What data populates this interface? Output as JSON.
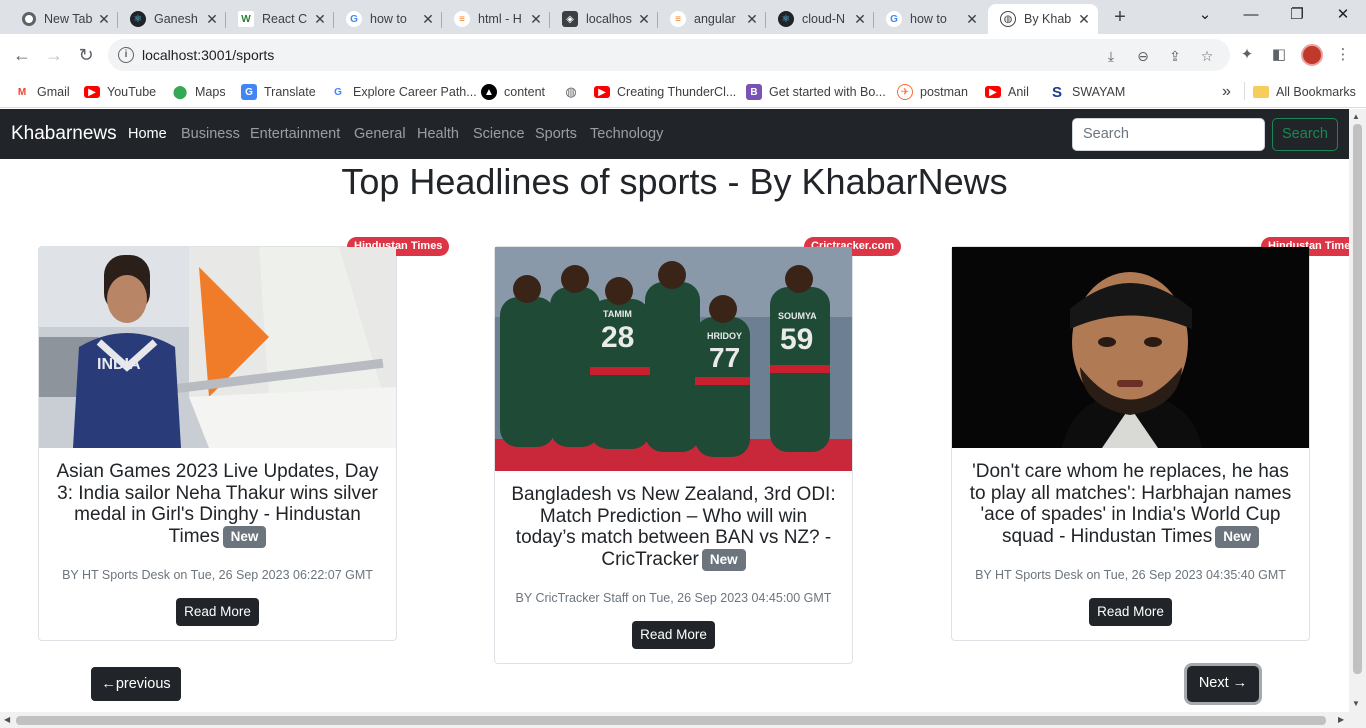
{
  "browser": {
    "tabs": [
      {
        "title": "New Tab"
      },
      {
        "title": "Ganesh"
      },
      {
        "title": "React C"
      },
      {
        "title": "how to"
      },
      {
        "title": "html - H"
      },
      {
        "title": "localhos"
      },
      {
        "title": "angular"
      },
      {
        "title": "cloud-N"
      },
      {
        "title": "how to"
      },
      {
        "title": "By Khab"
      }
    ],
    "url": "localhost:3001/sports",
    "bookmarks": [
      {
        "label": "Gmail",
        "icon": "gmail-icon"
      },
      {
        "label": "YouTube",
        "icon": "youtube-icon"
      },
      {
        "label": "Maps",
        "icon": "maps-icon"
      },
      {
        "label": "Translate",
        "icon": "translate-icon"
      },
      {
        "label": "Explore Career Path...",
        "icon": "career-icon"
      },
      {
        "label": "content",
        "icon": "content-icon"
      },
      {
        "label": "",
        "icon": "globe-icon"
      },
      {
        "label": "Creating ThunderCl...",
        "icon": "youtube-icon"
      },
      {
        "label": "Get started with Bo...",
        "icon": "bootstrap-icon"
      },
      {
        "label": "postman",
        "icon": "postman-icon"
      },
      {
        "label": "Anil",
        "icon": "youtube-icon"
      },
      {
        "label": "SWAYAM",
        "icon": "swayam-icon"
      }
    ],
    "all_bookmarks_label": "All Bookmarks"
  },
  "navbar": {
    "brand": "Khabarnews",
    "links": [
      "Home",
      "Business",
      "Entertainment",
      "General",
      "Health",
      "Science",
      "Sports",
      "Technology"
    ],
    "active": "Home",
    "search_placeholder": "Search",
    "search_button": "Search"
  },
  "page_title": "Top Headlines of sports - By KhabarNews",
  "articles": [
    {
      "source": "Hindustan Times",
      "title": "Asian Games 2023 Live Updates, Day 3: India sailor Neha Thakur wins silver medal in Girl's Dinghy - Hindustan Times",
      "badge": "New",
      "byline": "BY HT Sports Desk on Tue, 26 Sep 2023 06:22:07 GMT",
      "button": "Read More"
    },
    {
      "source": "Crictracker.com",
      "title": "Bangladesh vs New Zealand, 3rd ODI: Match Prediction – Who will win today’s match between BAN vs NZ? - CricTracker",
      "badge": "New",
      "byline": "BY CricTracker Staff on Tue, 26 Sep 2023 04:45:00 GMT",
      "button": "Read More"
    },
    {
      "source": "Hindustan Times",
      "title": "'Don't care whom he replaces, he has to play all matches': Harbhajan names 'ace of spades' in India's World Cup squad - Hindustan Times",
      "badge": "New",
      "byline": "BY HT Sports Desk on Tue, 26 Sep 2023 04:35:40 GMT",
      "button": "Read More"
    }
  ],
  "pagination": {
    "previous": "←previous",
    "next": "Next →"
  },
  "jersey_text": {
    "india": "INDIA",
    "players": [
      {
        "name": "TAMIM",
        "number": "28"
      },
      {
        "name": "HRIDOY",
        "number": "77"
      },
      {
        "name": "SOUMYA",
        "number": "59"
      }
    ]
  }
}
